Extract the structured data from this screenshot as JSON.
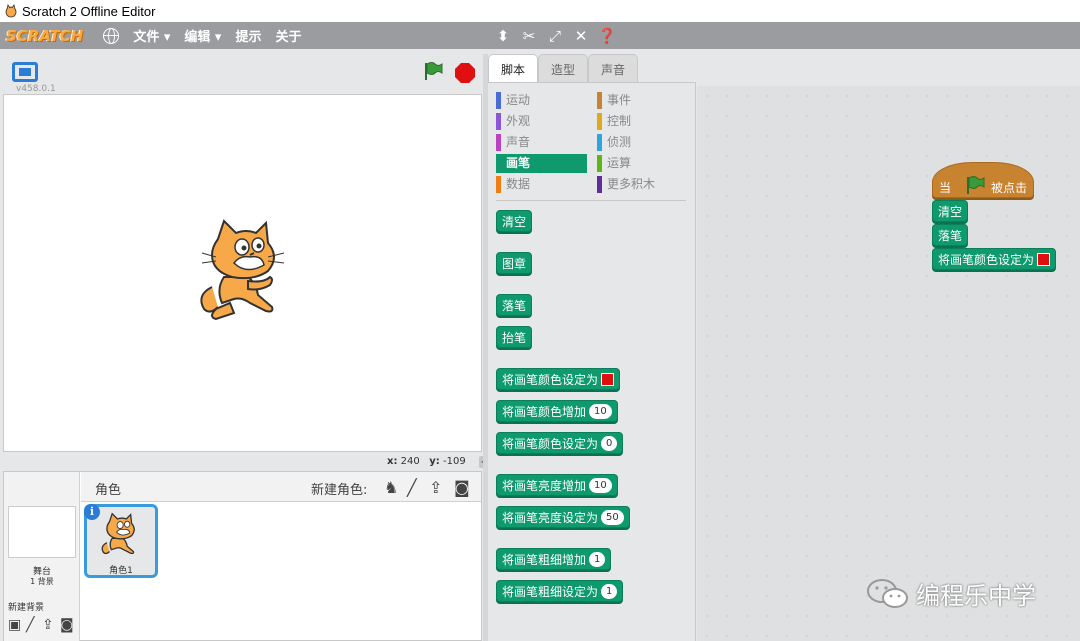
{
  "window": {
    "title": "Scratch 2 Offline Editor"
  },
  "menubar": {
    "logo": "SCRATCH",
    "items": [
      "文件 ▾",
      "编辑 ▾",
      "提示",
      "关于"
    ]
  },
  "stage": {
    "version": "v458.0.1",
    "coords": {
      "x_label": "x:",
      "x_value": "240",
      "y_label": "y:",
      "y_value": "-109"
    }
  },
  "sprite_panel": {
    "sprites_label": "角色",
    "new_sprite_label": "新建角色:",
    "stage_label": "舞台",
    "stage_sub": "1 背景",
    "new_backdrop_label": "新建背景",
    "sprite_name": "角色1",
    "info_label": "i"
  },
  "tabs": [
    "脚本",
    "造型",
    "声音"
  ],
  "categories": {
    "left": [
      {
        "label": "运动",
        "color": "#4a6cd4"
      },
      {
        "label": "外观",
        "color": "#8a55d7"
      },
      {
        "label": "声音",
        "color": "#bb42c3"
      },
      {
        "label": "画笔",
        "color": "#0e9a6c",
        "active": true
      },
      {
        "label": "数据",
        "color": "#ee7d16"
      }
    ],
    "right": [
      {
        "label": "事件",
        "color": "#c88330"
      },
      {
        "label": "控制",
        "color": "#e1a91a"
      },
      {
        "label": "侦测",
        "color": "#2ca5e2"
      },
      {
        "label": "运算",
        "color": "#5cb712"
      },
      {
        "label": "更多积木",
        "color": "#632d99"
      }
    ]
  },
  "palette_blocks": {
    "clear": "清空",
    "stamp": "图章",
    "pen_down": "落笔",
    "pen_up": "抬笔",
    "set_color_to": "将画笔颜色设定为",
    "change_color_by": "将画笔颜色增加",
    "change_color_by_value": "10",
    "set_color_to_num": "将画笔颜色设定为",
    "set_color_to_num_value": "0",
    "change_shade_by": "将画笔亮度增加",
    "change_shade_by_value": "10",
    "set_shade_to": "将画笔亮度设定为",
    "set_shade_to_value": "50",
    "change_size_by": "将画笔粗细增加",
    "change_size_by_value": "1",
    "set_size_to": "将画笔粗细设定为",
    "set_size_to_value": "1"
  },
  "script": {
    "hat_when": "当",
    "hat_clicked": "被点击",
    "clear": "清空",
    "pen_down": "落笔",
    "set_color_to": "将画笔颜色设定为"
  },
  "watermark": {
    "text": "编程乐中学"
  },
  "colors": {
    "pen": "#0e9a6c",
    "events": "#c88330",
    "stop": "#e01010",
    "flag": "#2e8b2e"
  }
}
